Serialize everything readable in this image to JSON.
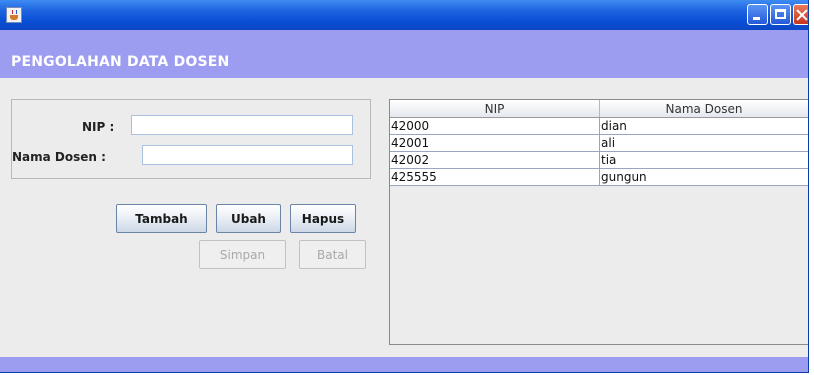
{
  "window": {
    "icon": "java-cup-icon",
    "controls": [
      "minimize-icon",
      "maximize-icon",
      "close-icon"
    ]
  },
  "header": {
    "title": "PENGOLAHAN DATA DOSEN"
  },
  "form": {
    "nip_label": "NIP :",
    "nip_value": "",
    "nama_label": "Nama Dosen :",
    "nama_value": ""
  },
  "buttons": {
    "tambah": "Tambah",
    "ubah": "Ubah",
    "hapus": "Hapus",
    "simpan": "Simpan",
    "batal": "Batal"
  },
  "table": {
    "columns": [
      "NIP",
      "Nama Dosen"
    ],
    "rows": [
      [
        "42000",
        "dian"
      ],
      [
        "42001",
        "ali"
      ],
      [
        "42002",
        "tia"
      ],
      [
        "425555",
        "gungun"
      ]
    ]
  },
  "colors": {
    "title_bar": "#0a4fd6",
    "header_band": "#9c9cf0",
    "window_bg": "#ececec"
  }
}
